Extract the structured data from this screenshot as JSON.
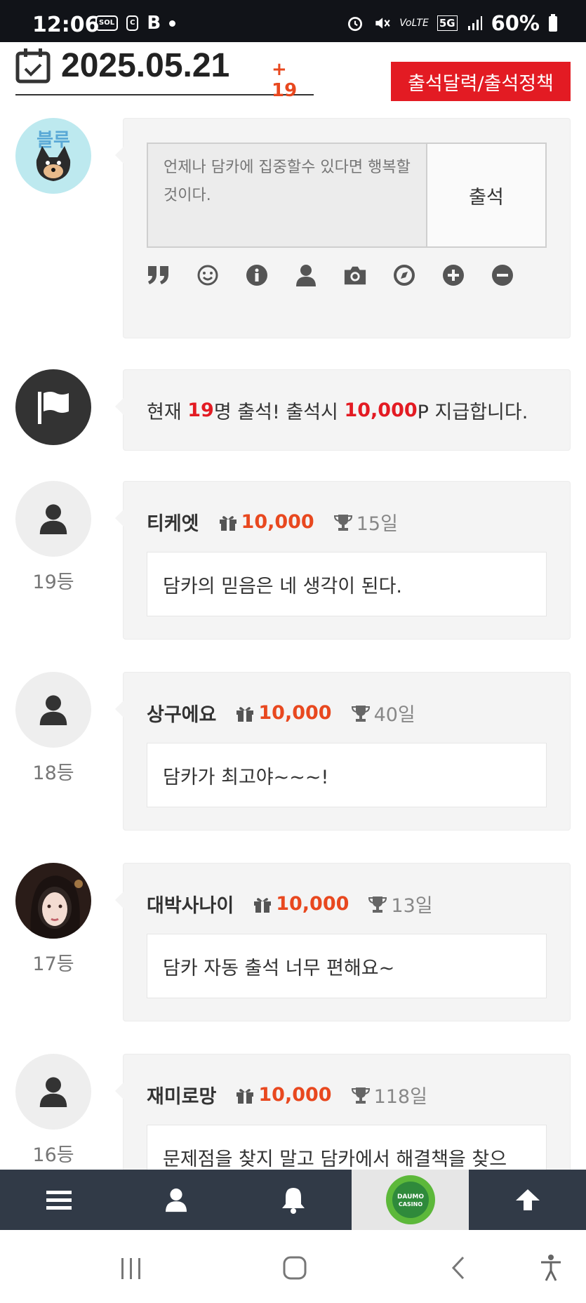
{
  "status_bar": {
    "time": "12:06",
    "battery": "60%",
    "network": "5G"
  },
  "header": {
    "date": "2025.05.21",
    "plus_count": "+ 19",
    "policy_button": "출석달력/출석정책"
  },
  "composer": {
    "placeholder": "언제나 담카에 집중할수 있다면 행복할것이다.",
    "submit_label": "출석",
    "toolbar_icons": [
      "quote-icon",
      "smiley-icon",
      "info-icon",
      "user-icon",
      "camera-icon",
      "compass-icon",
      "plus-circle-icon",
      "minus-circle-icon"
    ]
  },
  "notice": {
    "prefix": "현재 ",
    "count": "19",
    "mid": "명 출석! 출석시 ",
    "points": "10,000",
    "suffix": "P 지급합니다."
  },
  "entries": [
    {
      "rank": "19등",
      "nick": "티케엣",
      "points": "10,000",
      "days": "15일",
      "message": "담카의 믿음은 네 생각이 된다.",
      "avatar": "default"
    },
    {
      "rank": "18등",
      "nick": "상구에요",
      "points": "10,000",
      "days": "40일",
      "message": "담카가 최고야~~~!",
      "avatar": "default"
    },
    {
      "rank": "17등",
      "nick": "대박사나이",
      "points": "10,000",
      "days": "13일",
      "message": "담카 자동 출석 너무 편해요~",
      "avatar": "photo"
    },
    {
      "rank": "16등",
      "nick": "재미로망",
      "points": "10,000",
      "days": "118일",
      "message": "문제점을 찾지 말고 담카에서 해결책을 찾으",
      "avatar": "default"
    }
  ],
  "bottom_nav": {
    "items": [
      "menu-icon",
      "user-icon",
      "bell-icon",
      "daumo-casino-logo",
      "arrow-up-icon"
    ],
    "logo_text": "DAUMO CASINO"
  },
  "colors": {
    "accent_red": "#e31b23",
    "points_orange": "#e8481f",
    "nav_bg": "#313a47"
  }
}
